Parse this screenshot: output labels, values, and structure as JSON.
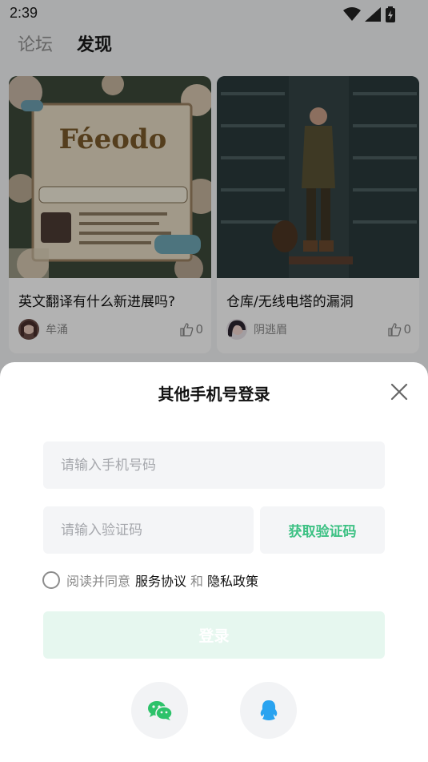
{
  "status_bar": {
    "time": "2:39"
  },
  "tabs": [
    {
      "label": "论坛",
      "active": false
    },
    {
      "label": "发现",
      "active": true
    }
  ],
  "cards": [
    {
      "title": "英文翻译有什么新进展吗?",
      "author": "牟涌",
      "likes": "0"
    },
    {
      "title": "仓库/无线电塔的漏洞",
      "author": "阴逃眉",
      "likes": "0"
    }
  ],
  "login_sheet": {
    "title": "其他手机号登录",
    "phone_placeholder": "请输入手机号码",
    "code_placeholder": "请输入验证码",
    "get_code_label": "获取验证码",
    "agree_prefix": "阅读并同意",
    "service_agreement": "服务协议",
    "and": "和",
    "privacy_policy": "隐私政策",
    "login_label": "登录",
    "social": [
      {
        "icon": "wechat-icon",
        "color": "#2dc26a"
      },
      {
        "icon": "qq-icon",
        "color": "#2aa3f0"
      }
    ]
  },
  "colors": {
    "accent": "#3dc184",
    "login_disabled_bg": "#e6f7ef",
    "field_bg": "#f4f5f7"
  }
}
